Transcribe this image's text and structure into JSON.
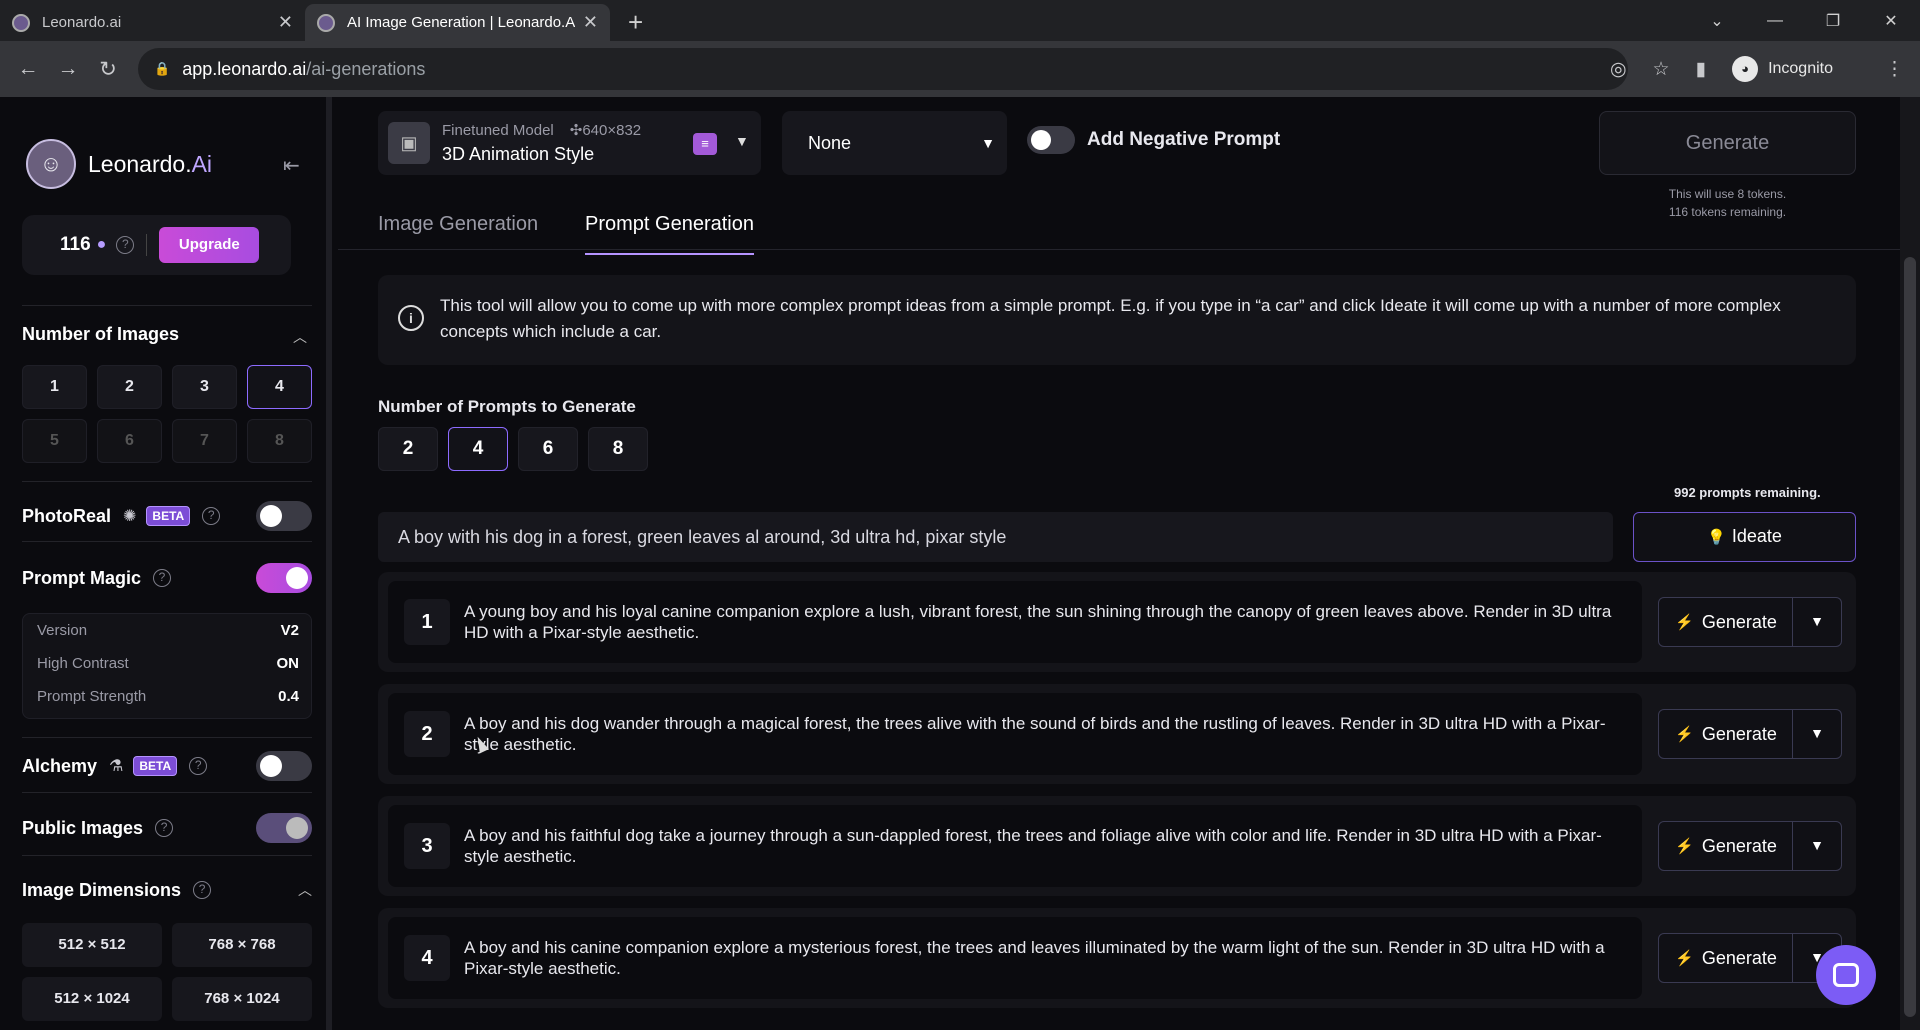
{
  "browser": {
    "tabs": [
      {
        "title": "Leonardo.ai"
      },
      {
        "title": "AI Image Generation | Leonardo.Ai"
      }
    ],
    "url_host": "app.leonardo.ai",
    "url_path": "/ai-generations",
    "profile": "Incognito"
  },
  "sidebar": {
    "brand": "Leonardo.",
    "brand_accent": "Ai",
    "tokens": "116",
    "upgrade": "Upgrade",
    "num_images_title": "Number of Images",
    "num_images": [
      "1",
      "2",
      "3",
      "4",
      "5",
      "6",
      "7",
      "8"
    ],
    "num_images_selected": "4",
    "photoreal": "PhotoReal",
    "beta": "BETA",
    "prompt_magic": "Prompt Magic",
    "settings": [
      {
        "k": "Version",
        "v": "V2"
      },
      {
        "k": "High Contrast",
        "v": "ON"
      },
      {
        "k": "Prompt Strength",
        "v": "0.4"
      }
    ],
    "alchemy": "Alchemy",
    "public_images": "Public Images",
    "image_dimensions": "Image Dimensions",
    "dims": [
      "512 × 512",
      "768 × 768",
      "512 × 1024",
      "768 × 1024"
    ]
  },
  "toolbar": {
    "model_type": "Finetuned Model",
    "model_dims": "640×832",
    "model_name": "3D Animation Style",
    "preset": "None",
    "negative_prompt": "Add Negative Prompt",
    "generate": "Generate",
    "token_note_1": "This will use 8 tokens.",
    "token_note_2": "116 tokens remaining."
  },
  "tabs": {
    "image_generation": "Image Generation",
    "prompt_generation": "Prompt Generation"
  },
  "info": "This tool will allow you to come up with more complex prompt ideas from a simple prompt. E.g. if you type in “a car” and click Ideate it will come up with a number of more complex concepts which include a car.",
  "prompts": {
    "count_label": "Number of Prompts to Generate",
    "counts": [
      "2",
      "4",
      "6",
      "8"
    ],
    "selected": "4",
    "remaining": "992 prompts remaining.",
    "input_value": "A boy with his dog in a forest, green leaves al around, 3d ultra hd, pixar style",
    "ideate": "Ideate",
    "generate_label": "Generate",
    "results": [
      {
        "n": "1",
        "text": "A young boy and his loyal canine companion explore a lush, vibrant forest, the sun shining through the canopy of green leaves above. Render in 3D ultra HD with a Pixar-style aesthetic."
      },
      {
        "n": "2",
        "text": "A boy and his dog wander through a magical forest, the trees alive with the sound of birds and the rustling of leaves. Render in 3D ultra HD with a Pixar-style aesthetic."
      },
      {
        "n": "3",
        "text": "A boy and his faithful dog take a journey through a sun-dappled forest, the trees and foliage alive with color and life. Render in 3D ultra HD with a Pixar-style aesthetic."
      },
      {
        "n": "4",
        "text": "A boy and his canine companion explore a mysterious forest, the trees and leaves illuminated by the warm light of the sun. Render in 3D ultra HD with a Pixar-style aesthetic."
      }
    ]
  },
  "colors": {
    "accent": "#b593ff",
    "upgrade": "#c94bd8",
    "bg": "#0b0b0f"
  }
}
